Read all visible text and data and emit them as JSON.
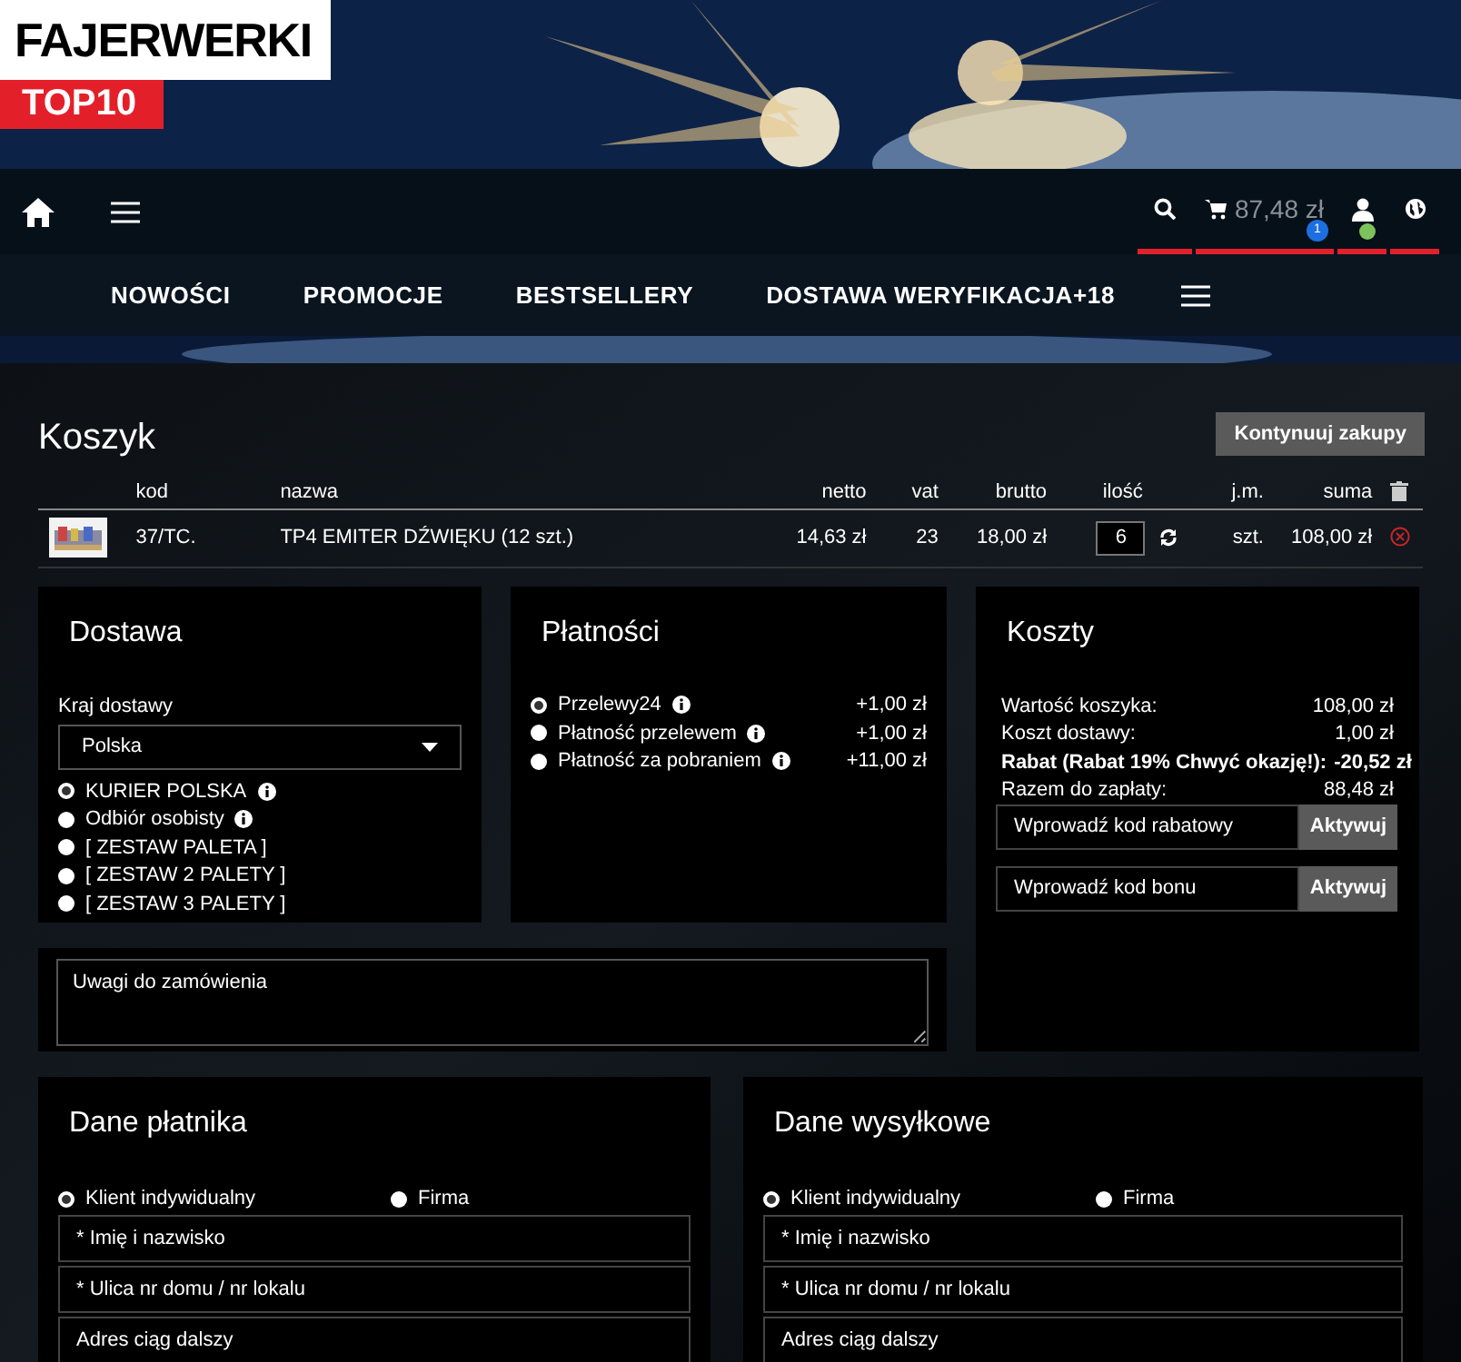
{
  "logo": {
    "name": "FAJERWERKI",
    "badge": "TOP10"
  },
  "toolbar": {
    "cart_total": "87,48 zł",
    "cart_count": "1"
  },
  "menu": [
    "NOWOŚCI",
    "PROMOCJE",
    "BESTSELLERY",
    "DOSTAWA WERYFIKACJA+18"
  ],
  "cart": {
    "title": "Koszyk",
    "continue_button": "Kontynuuj zakupy",
    "columns": [
      "kod",
      "nazwa",
      "netto",
      "vat",
      "brutto",
      "ilość",
      "j.m.",
      "suma"
    ],
    "rows": [
      {
        "kod": "37/TC.",
        "nazwa": "TP4 EMITER DŹWIĘKU (12 szt.)",
        "netto": "14,63 zł",
        "vat": "23",
        "brutto": "18,00 zł",
        "ilosc": "6",
        "jm": "szt.",
        "suma": "108,00 zł"
      }
    ]
  },
  "delivery": {
    "title": "Dostawa",
    "country_label": "Kraj dostawy",
    "country": "Polska",
    "options": [
      {
        "label": "KURIER POLSKA",
        "info": true,
        "selected": true
      },
      {
        "label": "Odbiór osobisty",
        "info": true,
        "selected": false
      },
      {
        "label": "[ ZESTAW PALETA ]",
        "info": false,
        "selected": false
      },
      {
        "label": "[ ZESTAW 2 PALETY ]",
        "info": false,
        "selected": false
      },
      {
        "label": "[ ZESTAW 3 PALETY ]",
        "info": false,
        "selected": false
      }
    ]
  },
  "payments": {
    "title": "Płatności",
    "options": [
      {
        "label": "Przelewy24",
        "price": "+1,00 zł",
        "selected": true
      },
      {
        "label": "Płatność przelewem",
        "price": "+1,00 zł",
        "selected": false
      },
      {
        "label": "Płatność za pobraniem",
        "price": "+11,00 zł",
        "selected": false
      }
    ]
  },
  "costs": {
    "title": "Koszty",
    "lines": [
      {
        "label": "Wartość koszyka:",
        "value": "108,00 zł",
        "bold": false
      },
      {
        "label": "Koszt dostawy:",
        "value": "1,00 zł",
        "bold": false
      },
      {
        "label": "Rabat (Rabat 19% Chwyć okazję!):",
        "value": "-20,52 zł",
        "bold": true
      },
      {
        "label": "Razem do zapłaty:",
        "value": "88,48 zł",
        "bold": false
      }
    ],
    "codes": [
      {
        "placeholder": "Wprowadź kod rabatowy",
        "button": "Aktywuj"
      },
      {
        "placeholder": "Wprowadź kod bonu",
        "button": "Aktywuj"
      }
    ]
  },
  "notes": {
    "placeholder": "Uwagi do zamówienia"
  },
  "forms": [
    {
      "title": "Dane płatnika",
      "types": [
        {
          "label": "Klient indywidualny",
          "selected": true
        },
        {
          "label": "Firma",
          "selected": false
        }
      ],
      "fields": [
        {
          "placeholder": "* Imię i nazwisko"
        },
        {
          "placeholder": "* Ulica nr domu / nr lokalu"
        },
        {
          "placeholder": "Adres ciąg dalszy"
        }
      ]
    },
    {
      "title": "Dane wysyłkowe",
      "types": [
        {
          "label": "Klient indywidualny",
          "selected": true
        },
        {
          "label": "Firma",
          "selected": false
        }
      ],
      "fields": [
        {
          "placeholder": "* Imię i nazwisko"
        },
        {
          "placeholder": "* Ulica nr domu / nr lokalu"
        },
        {
          "placeholder": "Adres ciąg dalszy"
        }
      ]
    }
  ]
}
